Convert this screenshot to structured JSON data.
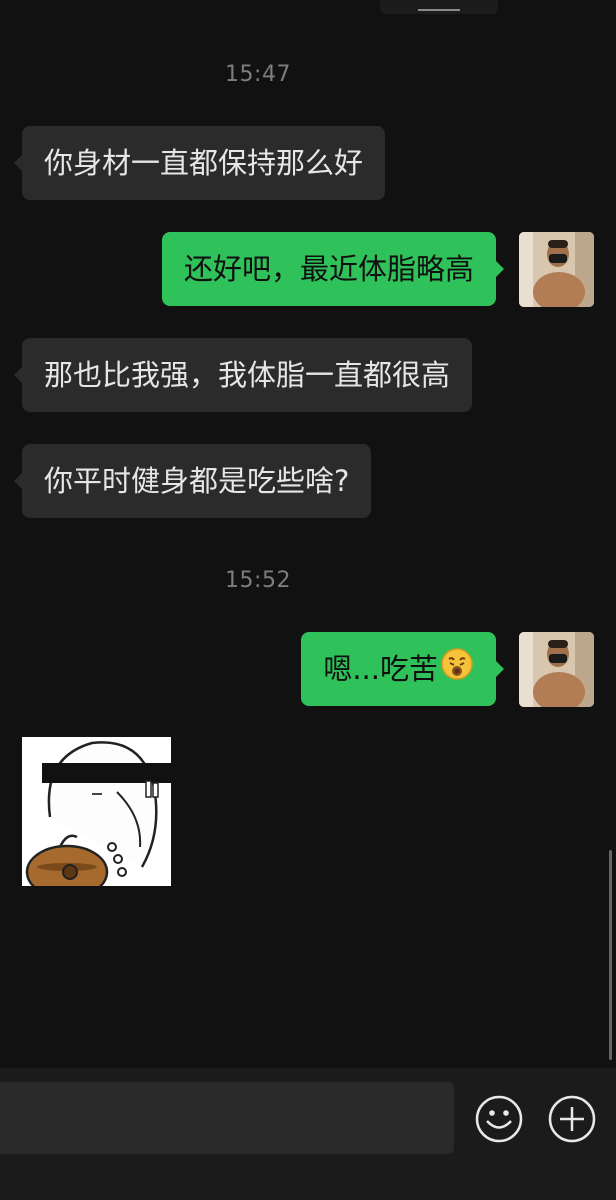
{
  "timestamps": [
    "15:47",
    "15:52"
  ],
  "messages": [
    {
      "side": "left",
      "text": "你身材一直都保持那么好"
    },
    {
      "side": "right",
      "text": "还好吧，最近体脂略高"
    },
    {
      "side": "left",
      "text": "那也比我强，我体脂一直都很高"
    },
    {
      "side": "left",
      "text": "你平时健身都是吃些啥?"
    },
    {
      "side": "right",
      "text": "嗯...吃苦",
      "emoji": "exhausted-face-emoji"
    },
    {
      "side": "left",
      "type": "sticker",
      "sticker": "blindfolded-figure-sticker"
    }
  ],
  "input_bar": {
    "emoji_button_icon": "smiley-icon",
    "more_button_icon": "plus-circle-icon"
  },
  "colors": {
    "background": "#111111",
    "incoming_bubble": "#2b2b2b",
    "outgoing_bubble": "#2fc15a",
    "timestamp": "#7d7d7d"
  }
}
